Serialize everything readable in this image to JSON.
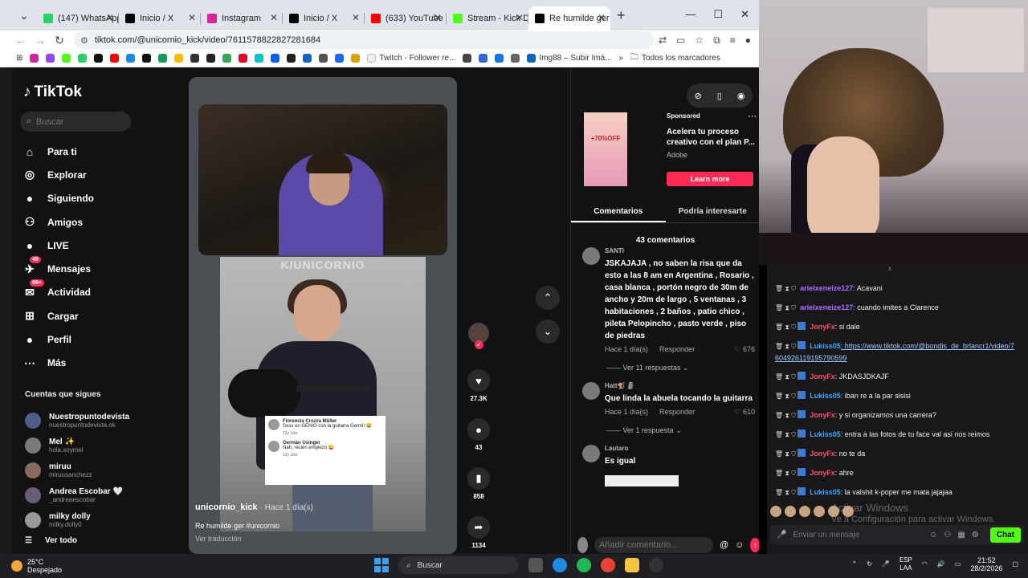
{
  "browser": {
    "tabs": [
      {
        "label": "(147) WhatsApp",
        "color": "#25d366",
        "icon": "whatsapp-icon"
      },
      {
        "label": "Inicio / X",
        "color": "#000000",
        "icon": "x-icon"
      },
      {
        "label": "Instagram",
        "color": "#d6249f",
        "icon": "instagram-icon"
      },
      {
        "label": "Inicio / X",
        "color": "#000000",
        "icon": "x-icon"
      },
      {
        "label": "(633) YouTube",
        "color": "#ff0000",
        "icon": "youtube-icon"
      },
      {
        "label": "Stream - Kick Da",
        "color": "#53fc18",
        "icon": "kick-icon"
      },
      {
        "label": "Re humilde ger #",
        "color": "#000000",
        "icon": "tiktok-icon",
        "active": true
      }
    ],
    "url": "tiktok.com/@unicornio_kick/video/7611578822827281684",
    "bookmarks_text_1": "Twitch - Follower re...",
    "bookmarks_text_2": "Img88 – Subir Imá...",
    "bookmarks_folder": "Todos los marcadores"
  },
  "tiktok": {
    "logo": "TikTok",
    "search_placeholder": "Buscar",
    "nav": [
      {
        "label": "Para ti",
        "icon": "home-icon"
      },
      {
        "label": "Explorar",
        "icon": "compass-icon"
      },
      {
        "label": "Siguiendo",
        "icon": "following-icon"
      },
      {
        "label": "Amigos",
        "icon": "friends-icon"
      },
      {
        "label": "LIVE",
        "icon": "live-icon"
      },
      {
        "label": "Mensajes",
        "icon": "messages-icon",
        "badge": "49"
      },
      {
        "label": "Actividad",
        "icon": "activity-icon",
        "badge": "99+"
      },
      {
        "label": "Cargar",
        "icon": "upload-icon"
      },
      {
        "label": "Perfil",
        "icon": "profile-icon"
      },
      {
        "label": "Más",
        "icon": "more-icon"
      }
    ],
    "following_header": "Cuentas que sigues",
    "following": [
      {
        "name": "Nuestropuntodevista",
        "user": "nuestropuntodevista.ok"
      },
      {
        "name": "Mel ✨",
        "user": "hola.soymel"
      },
      {
        "name": "miruu",
        "user": "miruusanchezz"
      },
      {
        "name": "Andrea Escobar 🤍",
        "user": "_andreaescobar"
      },
      {
        "name": "milky dolly",
        "user": "milky.dolly0"
      }
    ],
    "ver_todo": "Ver todo",
    "video": {
      "watermark": "K/UNICORNIO",
      "author": "unicornio_kick",
      "time": "· Hace 1 día(s)",
      "desc": "Re humilde ger #unicornio",
      "translate": "Ver traducción",
      "fb_comments": [
        {
          "name": "Florencia Crozza Müller",
          "text": "Soss un GENIO con la guitarra Germi! 😀",
          "meta": "12y   Like"
        },
        {
          "name": "Germán Usinger",
          "text": "Nah, recién empiezo 😜",
          "meta": "12y   Like"
        }
      ]
    },
    "actions": {
      "likes": "27.3K",
      "comments": "43",
      "saves": "858",
      "shares": "1134"
    },
    "ad": {
      "sponsored": "Sponsored",
      "title": "Acelera tu proceso creativo con el plan P...",
      "brand": "Adobe",
      "cta": "Learn more",
      "img_text": "+70%OFF"
    },
    "tabs": {
      "comments": "Comentarios",
      "interest": "Podría interesarte"
    },
    "comment_count": "43 comentarios",
    "comments": [
      {
        "user": "SANTI",
        "text": "JSKAJAJA , no saben la risa que da esto a las 8 am en Argentina , Rosario , casa blanca , portón negro de 30m de ancho y 20m de largo , 5 ventanas , 3 habitaciones , 2 baños , patio chico , pileta Pelopincho , pasto verde , piso de piedras",
        "time": "Hace 1 día(s)",
        "reply": "Responder",
        "likes": "676",
        "replies": "Ver 11 respuestas"
      },
      {
        "user": "Hatt🐒 🗿",
        "text": "Que linda la abuela tocando la guitarra",
        "time": "Hace 1 día(s)",
        "reply": "Responder",
        "likes": "610",
        "replies": "Ver 1 respuesta"
      },
      {
        "user": "Lautaro",
        "text": "Es igual"
      }
    ],
    "add_comment_placeholder": "Añadir comentario..."
  },
  "chat": {
    "messages": [
      {
        "user": "arielxeneize127",
        "text": ": Acavani",
        "color": "#b06bff"
      },
      {
        "user": "arielxeneize127",
        "text": ": cuando imites a Clarence",
        "color": "#b06bff"
      },
      {
        "user": "JonyFx",
        "text": ": si dale",
        "color": "#ff4d6d"
      },
      {
        "user": "Lukiss05",
        "text": ": https://www.tiktok.com/@bondis_de_brlancr1/video/7604926119195790599",
        "color": "#3ea6ff"
      },
      {
        "user": "JonyFx",
        "text": ": JKDASJDKAJF",
        "color": "#ff4d6d"
      },
      {
        "user": "Lukiss05",
        "text": ": iban re a la par sisisi",
        "color": "#3ea6ff"
      },
      {
        "user": "JonyFx",
        "text": ": y si organizamos una carrera?",
        "color": "#ff4d6d"
      },
      {
        "user": "Lukiss05",
        "text": ": entra a las fotos de tu face val asi nos reimos",
        "color": "#3ea6ff"
      },
      {
        "user": "JonyFx",
        "text": ": no te da",
        "color": "#ff4d6d"
      },
      {
        "user": "JonyFx",
        "text": ": ahre",
        "color": "#ff4d6d"
      },
      {
        "user": "Lukiss05",
        "text": ": la valshit k-poper me mata jajajaa",
        "color": "#3ea6ff"
      }
    ],
    "activate_1": "Activar Windows",
    "activate_2": "Ve a Configuración para activar Windows.",
    "input_placeholder": "Enviar un mensaje",
    "send_label": "Chat"
  },
  "taskbar": {
    "temp": "25°C",
    "weather": "Despejado",
    "search": "Buscar",
    "lang_1": "ESP",
    "lang_2": "LAA",
    "time": "21:52",
    "date": "28/2/2026"
  }
}
